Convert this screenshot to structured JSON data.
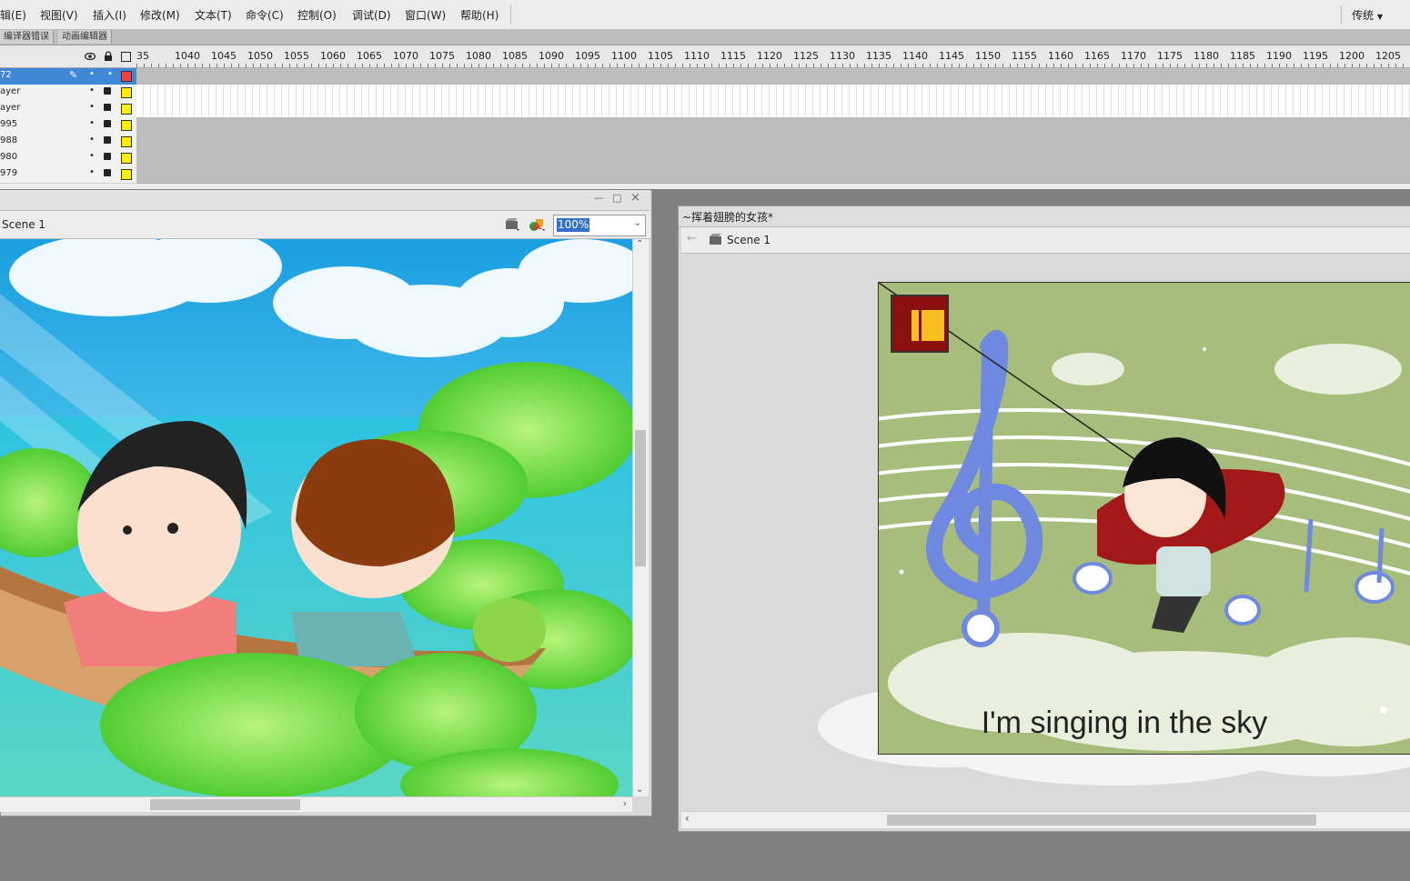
{
  "menubar": {
    "items": [
      "辑(E)",
      "视图(V)",
      "插入(I)",
      "修改(M)",
      "文本(T)",
      "命令(C)",
      "控制(O)",
      "调试(D)",
      "窗口(W)",
      "帮助(H)"
    ],
    "workspace": "传统"
  },
  "panel_tabs": [
    "编译器错误",
    "动画编辑器"
  ],
  "timeline": {
    "frame_labels": [
      "35",
      "1040",
      "1045",
      "1050",
      "1055",
      "1060",
      "1065",
      "1070",
      "1075",
      "1080",
      "1085",
      "1090",
      "1095",
      "1100",
      "1105",
      "1110",
      "1115",
      "1120",
      "1125",
      "1130",
      "1135",
      "1140",
      "1145",
      "1150",
      "1155",
      "1160",
      "1165",
      "1170",
      "1175",
      "1180",
      "1185",
      "1190",
      "1195",
      "1200",
      "1205",
      "1"
    ],
    "layers": [
      {
        "name": "72",
        "selected": true,
        "color": "#f04040"
      },
      {
        "name": "ayer",
        "selected": false,
        "color": "#ffef00"
      },
      {
        "name": "ayer",
        "selected": false,
        "color": "#ffef00"
      },
      {
        "name": "995",
        "selected": false,
        "color": "#ffef00"
      },
      {
        "name": "988",
        "selected": false,
        "color": "#ffef00"
      },
      {
        "name": "980",
        "selected": false,
        "color": "#ffef00"
      },
      {
        "name": "979",
        "selected": false,
        "color": "#ffef00"
      }
    ]
  },
  "doc_left": {
    "scene": "Scene 1",
    "zoom": "100%"
  },
  "doc_right": {
    "title": "~挥着翅膀的女孩*",
    "scene": "Scene 1",
    "caption": "I'm singing in the sky"
  },
  "colors": {
    "sky": "#1ba7e0",
    "water": "#3ec6d8",
    "lotus_leaf": "#5ed43a",
    "right_stage_bg": "#a6bd7c",
    "selection": "#3f88d6"
  }
}
